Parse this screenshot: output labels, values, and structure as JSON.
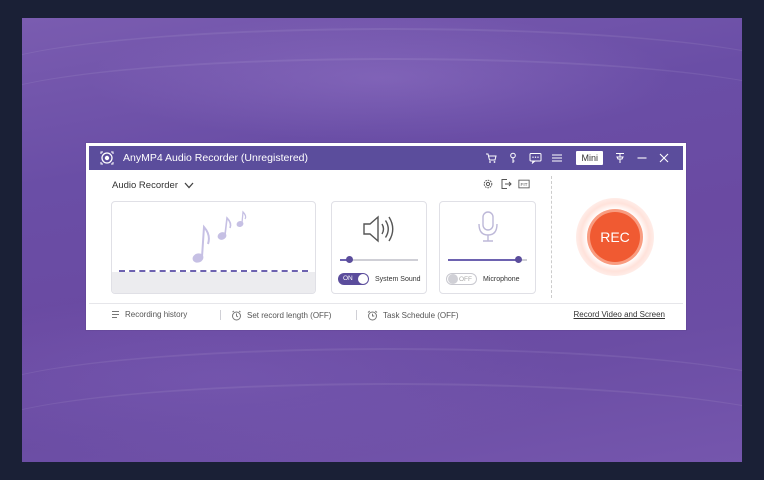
{
  "window": {
    "title": "AnyMP4 Audio Recorder (Unregistered)",
    "mini_label": "Mini"
  },
  "mode": {
    "label": "Audio Recorder"
  },
  "system_sound": {
    "toggle": "ON",
    "label": "System Sound",
    "volume": 0.12
  },
  "microphone": {
    "toggle": "OFF",
    "label": "Microphone",
    "volume": 0.88
  },
  "rec": {
    "label": "REC"
  },
  "footer": {
    "history": "Recording history",
    "length": "Set record length (OFF)",
    "schedule": "Task Schedule (OFF)",
    "video_link": "Record Video and Screen"
  },
  "colors": {
    "accent": "#5b4d9c",
    "rec": "#f05a32"
  }
}
